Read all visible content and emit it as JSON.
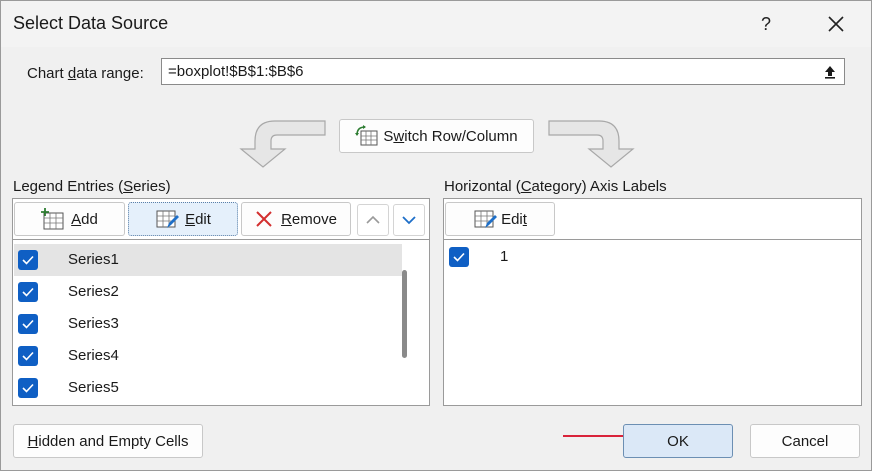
{
  "dialog": {
    "title": "Select Data Source",
    "help_label": "?",
    "close_label": "✕"
  },
  "range": {
    "label_pre": "Chart ",
    "label_underline": "d",
    "label_post": "ata range:",
    "value": "=boxplot!$B$1:$B$6"
  },
  "switch_button": {
    "pre": "S",
    "underline": "w",
    "post": "itch Row/Column"
  },
  "legend": {
    "title_pre": "Legend Entries (",
    "title_underline": "S",
    "title_post": "eries)",
    "add_pre": "",
    "add_underline": "A",
    "add_post": "dd",
    "edit_pre": "",
    "edit_underline": "E",
    "edit_post": "dit",
    "remove_pre": "",
    "remove_underline": "R",
    "remove_post": "emove",
    "series": [
      {
        "name": "Series1",
        "checked": true
      },
      {
        "name": "Series2",
        "checked": true
      },
      {
        "name": "Series3",
        "checked": true
      },
      {
        "name": "Series4",
        "checked": true
      },
      {
        "name": "Series5",
        "checked": true
      }
    ]
  },
  "axis": {
    "title_pre": "Horizontal (",
    "title_underline": "C",
    "title_post": "ategory) Axis Labels",
    "edit_pre": "Edi",
    "edit_underline": "t",
    "edit_post": "",
    "labels": [
      {
        "name": "1",
        "checked": true
      }
    ]
  },
  "footer": {
    "hidden_pre": "",
    "hidden_underline": "H",
    "hidden_post": "idden and Empty Cells",
    "ok_label": "OK",
    "cancel_label": "Cancel"
  },
  "colors": {
    "checkbox": "#0f5fc4",
    "selected_row": "#e4e4e4",
    "annotation_arrow": "#d9233a",
    "remove_icon": "#d32f2f"
  }
}
